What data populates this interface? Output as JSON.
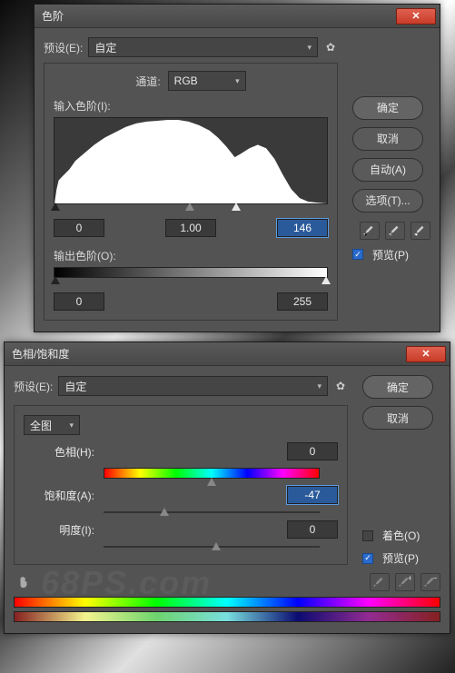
{
  "levels": {
    "title": "色阶",
    "preset_label": "预设(E):",
    "preset_value": "自定",
    "channel_label": "通道:",
    "channel_value": "RGB",
    "input_label": "输入色阶(I):",
    "input_black": "0",
    "input_gamma": "1.00",
    "input_white": "146",
    "output_label": "输出色阶(O):",
    "output_black": "0",
    "output_white": "255",
    "ok": "确定",
    "cancel": "取消",
    "auto": "自动(A)",
    "options": "选项(T)...",
    "preview": "预览(P)"
  },
  "hsl": {
    "title": "色相/饱和度",
    "preset_label": "预设(E):",
    "preset_value": "自定",
    "range": "全图",
    "hue_label": "色相(H):",
    "hue_value": "0",
    "sat_label": "饱和度(A):",
    "sat_value": "-47",
    "light_label": "明度(I):",
    "light_value": "0",
    "ok": "确定",
    "cancel": "取消",
    "colorize": "着色(O)",
    "preview": "预览(P)",
    "watermark": "68PS.com"
  }
}
